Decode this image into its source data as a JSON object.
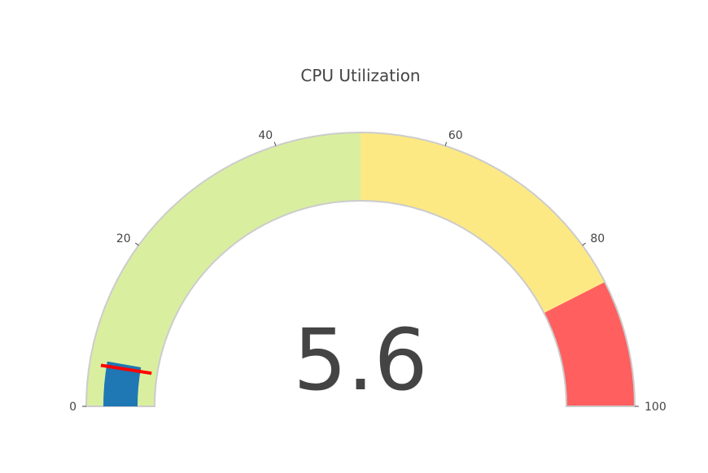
{
  "chart_data": {
    "type": "gauge",
    "title": "CPU Utilization",
    "value": 5.6,
    "value_label": "5.6",
    "range": [
      0,
      100
    ],
    "ticks": [
      0,
      20,
      40,
      60,
      80,
      100
    ],
    "tick_labels": [
      "0",
      "20",
      "40",
      "60",
      "80",
      "100"
    ],
    "steps": [
      {
        "range": [
          0,
          50
        ],
        "color": "#d9ef9f"
      },
      {
        "range": [
          50,
          85
        ],
        "color": "#fde983"
      },
      {
        "range": [
          85,
          100
        ],
        "color": "#ff5f5f"
      }
    ],
    "bar_color": "#1f77b4",
    "threshold": {
      "value": 5,
      "color": "#ff0000"
    },
    "border_color": "#cccccc"
  }
}
